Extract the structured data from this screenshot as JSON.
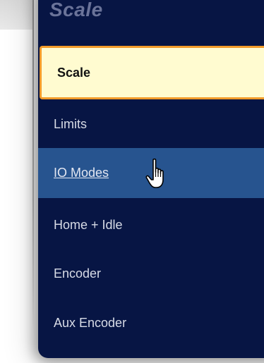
{
  "menu": {
    "title": "Scale",
    "items": [
      {
        "label": "Scale",
        "state": "selected"
      },
      {
        "label": "Limits",
        "state": "normal"
      },
      {
        "label": "IO Modes",
        "state": "hover"
      },
      {
        "label": "Home + Idle",
        "state": "normal"
      },
      {
        "label": "Encoder",
        "state": "normal"
      },
      {
        "label": "Aux Encoder",
        "state": "normal"
      }
    ]
  },
  "pointer": {
    "icon": "hand-pointer-icon"
  },
  "colors": {
    "panel": "#071544",
    "selected_fill": "#fffbd0",
    "selected_border": "#f29b2a",
    "hover_fill": "#27548f",
    "item_text": "#d7dbe6"
  }
}
